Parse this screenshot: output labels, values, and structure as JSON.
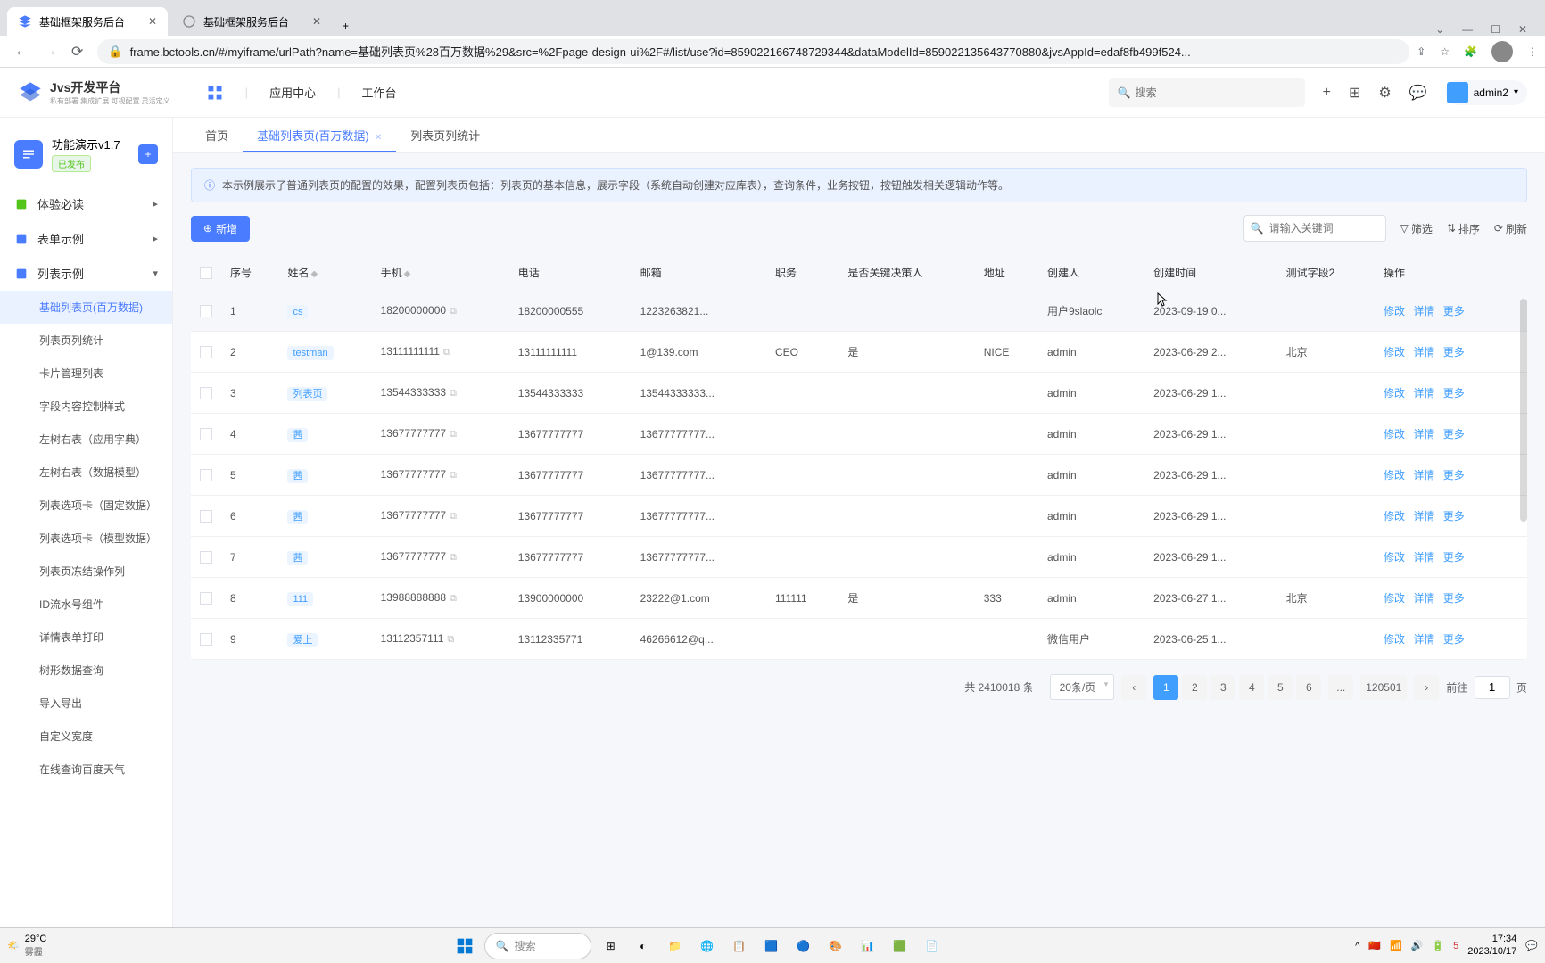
{
  "browser": {
    "tabs": [
      {
        "title": "基础框架服务后台",
        "active": true
      },
      {
        "title": "基础框架服务后台",
        "active": false
      }
    ],
    "url": "frame.bctools.cn/#/myiframe/urlPath?name=基础列表页%28百万数据%29&src=%2Fpage-design-ui%2F#/list/use?id=859022166748729344&dataModelId=859022135643770880&jvsAppId=edaf8fb499f524..."
  },
  "app": {
    "logo": {
      "title": "Jvs开发平台",
      "sub": "私有部署.集成扩展.可视配置.灵活定义"
    },
    "nav": {
      "appcenter": "应用中心",
      "workspace": "工作台"
    },
    "search_placeholder": "搜索",
    "user": "admin2"
  },
  "sidebar": {
    "project": {
      "name": "功能演示v1.7",
      "status": "已发布"
    },
    "groups": [
      {
        "label": "体验必读",
        "icon": "book",
        "expand": "right"
      },
      {
        "label": "表单示例",
        "icon": "form",
        "expand": "right"
      },
      {
        "label": "列表示例",
        "icon": "list",
        "expand": "down"
      }
    ],
    "subitems": [
      "基础列表页(百万数据)",
      "列表页列统计",
      "卡片管理列表",
      "字段内容控制样式",
      "左树右表（应用字典）",
      "左树右表（数据模型）",
      "列表选项卡（固定数据）",
      "列表选项卡（模型数据）",
      "列表页冻结操作列",
      "ID流水号组件",
      "详情表单打印",
      "树形数据查询",
      "导入导出",
      "自定义宽度",
      "在线查询百度天气"
    ]
  },
  "tabs": {
    "home": "首页",
    "active": "基础列表页(百万数据)",
    "stat": "列表页列统计"
  },
  "banner": "本示例展示了普通列表页的配置的效果，配置列表页包括：列表页的基本信息，展示字段（系统自动创建对应库表），查询条件，业务按钮，按钮触发相关逻辑动作等。",
  "toolbar": {
    "add": "新增",
    "search_placeholder": "请输入关键词",
    "filter": "筛选",
    "sort": "排序",
    "refresh": "刷新"
  },
  "columns": {
    "seq": "序号",
    "name": "姓名",
    "mobile": "手机",
    "phone": "电话",
    "email": "邮箱",
    "job": "职务",
    "decision": "是否关键决策人",
    "address": "地址",
    "creator": "创建人",
    "created": "创建时间",
    "test2": "测试字段2",
    "action": "操作"
  },
  "actions": {
    "edit": "修改",
    "detail": "详情",
    "more": "更多"
  },
  "rows": [
    {
      "seq": "1",
      "name": "cs",
      "mobile": "18200000000",
      "phone": "18200000555",
      "email": "1223263821...",
      "job": "",
      "decision": "",
      "address": "",
      "creator": "用户9slaolc",
      "created": "2023-09-19 0...",
      "test2": ""
    },
    {
      "seq": "2",
      "name": "testman",
      "mobile": "13111111111",
      "phone": "13111111111",
      "email": "1@139.com",
      "job": "CEO",
      "decision": "是",
      "address": "NICE",
      "creator": "admin",
      "created": "2023-06-29 2...",
      "test2": "北京"
    },
    {
      "seq": "3",
      "name": "列表页",
      "mobile": "13544333333",
      "phone": "13544333333",
      "email": "13544333333...",
      "job": "",
      "decision": "",
      "address": "",
      "creator": "admin",
      "created": "2023-06-29 1...",
      "test2": ""
    },
    {
      "seq": "4",
      "name": "茜",
      "mobile": "13677777777",
      "phone": "13677777777",
      "email": "13677777777...",
      "job": "",
      "decision": "",
      "address": "",
      "creator": "admin",
      "created": "2023-06-29 1...",
      "test2": ""
    },
    {
      "seq": "5",
      "name": "茜",
      "mobile": "13677777777",
      "phone": "13677777777",
      "email": "13677777777...",
      "job": "",
      "decision": "",
      "address": "",
      "creator": "admin",
      "created": "2023-06-29 1...",
      "test2": ""
    },
    {
      "seq": "6",
      "name": "茜",
      "mobile": "13677777777",
      "phone": "13677777777",
      "email": "13677777777...",
      "job": "",
      "decision": "",
      "address": "",
      "creator": "admin",
      "created": "2023-06-29 1...",
      "test2": ""
    },
    {
      "seq": "7",
      "name": "茜",
      "mobile": "13677777777",
      "phone": "13677777777",
      "email": "13677777777...",
      "job": "",
      "decision": "",
      "address": "",
      "creator": "admin",
      "created": "2023-06-29 1...",
      "test2": ""
    },
    {
      "seq": "8",
      "name": "111",
      "mobile": "13988888888",
      "phone": "13900000000",
      "email": "23222@1.com",
      "job": "111111",
      "decision": "是",
      "address": "333",
      "creator": "admin",
      "created": "2023-06-27 1...",
      "test2": "北京"
    },
    {
      "seq": "9",
      "name": "爱上",
      "mobile": "13112357111",
      "phone": "13112335771",
      "email": "46266612@q...",
      "job": "",
      "decision": "",
      "address": "",
      "creator": "微信用户",
      "created": "2023-06-25 1...",
      "test2": ""
    }
  ],
  "pagination": {
    "total_label": "共 2410018 条",
    "page_size": "20条/页",
    "pages": [
      "1",
      "2",
      "3",
      "4",
      "5",
      "6"
    ],
    "last": "120501",
    "goto_prefix": "前往",
    "goto_value": "1",
    "goto_suffix": "页"
  },
  "taskbar": {
    "temp": "29°C",
    "weather": "雾霾",
    "search": "搜索",
    "time": "17:34",
    "date": "2023/10/17"
  }
}
